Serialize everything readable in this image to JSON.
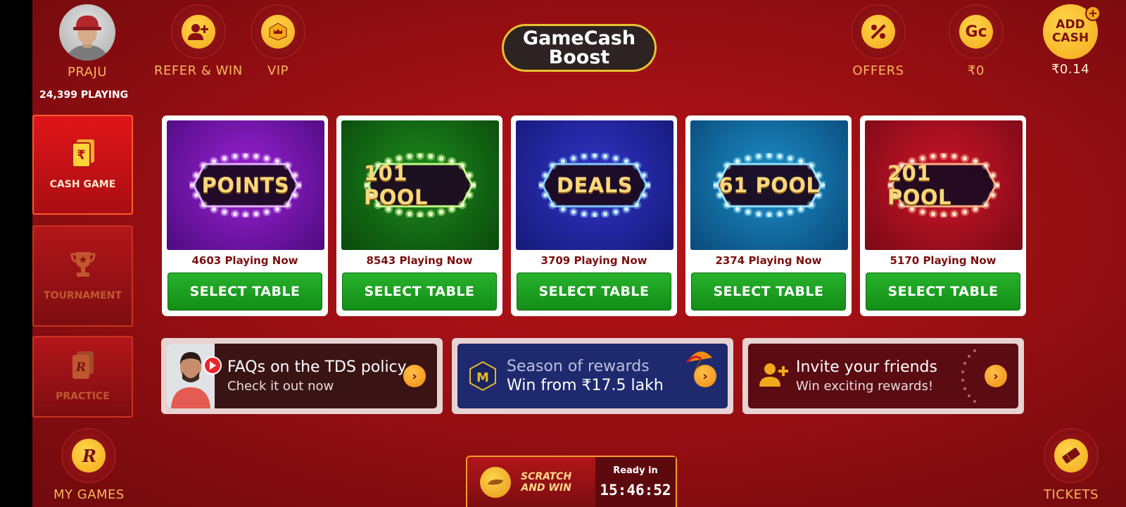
{
  "header": {
    "profile": {
      "name": "PRAJU"
    },
    "refer": {
      "label": "REFER & WIN"
    },
    "vip": {
      "label": "VIP"
    },
    "boost": {
      "line1": "GameCash",
      "line2": "Boost"
    },
    "offers": {
      "label": "OFFERS"
    },
    "gamecash": {
      "icon_text": "Gc",
      "label": "₹0"
    },
    "add_cash": {
      "line1": "ADD",
      "line2": "CASH",
      "label": "₹0.14"
    }
  },
  "playing_count": "24,399 PLAYING",
  "sidebar": {
    "items": [
      {
        "label": "CASH GAME",
        "icon": "rupee-card-icon",
        "active": true
      },
      {
        "label": "TOURNAMENT",
        "icon": "trophy-icon",
        "active": false
      },
      {
        "label": "PRACTICE",
        "icon": "practice-card-icon",
        "active": false
      }
    ]
  },
  "games": [
    {
      "title": "POINTS",
      "playing": "4603 Playing Now",
      "button": "SELECT TABLE",
      "bg1": "#9a22d4",
      "bg2": "#4e0b80",
      "light": "#e7b8ff"
    },
    {
      "title": "101 POOL",
      "playing": "8543 Playing Now",
      "button": "SELECT TABLE",
      "bg1": "#1e8a1e",
      "bg2": "#0a4a0c",
      "light": "#c9ff8a"
    },
    {
      "title": "DEALS",
      "playing": "3709 Playing Now",
      "button": "SELECT TABLE",
      "bg1": "#3333c8",
      "bg2": "#141a78",
      "light": "#8ad0ff"
    },
    {
      "title": "61 POOL",
      "playing": "2374 Playing Now",
      "button": "SELECT TABLE",
      "bg1": "#1c8fc8",
      "bg2": "#0a4a7a",
      "light": "#9ae6ff"
    },
    {
      "title": "201 POOL",
      "playing": "5170 Playing Now",
      "button": "SELECT TABLE",
      "bg1": "#d0142a",
      "bg2": "#7a0a16",
      "light": "#ffb48a"
    }
  ],
  "banners": [
    {
      "line1": "FAQs on the TDS policy",
      "line2": "Check it out now",
      "bg": "#3a1414"
    },
    {
      "line1": "Season of rewards",
      "line2": "Win from ₹17.5 lakh",
      "badge": "M",
      "bg": "#1f2a6e"
    },
    {
      "line1": "Invite your friends",
      "line2": "Win exciting rewards!",
      "bg": "#5a0c12"
    }
  ],
  "bottom": {
    "my_games": {
      "label": "MY GAMES"
    },
    "tickets": {
      "label": "TICKETS"
    },
    "scratch": {
      "line1": "SCRATCH",
      "line2": "AND WIN",
      "ready_label": "Ready in",
      "timer": "15:46:52"
    }
  }
}
